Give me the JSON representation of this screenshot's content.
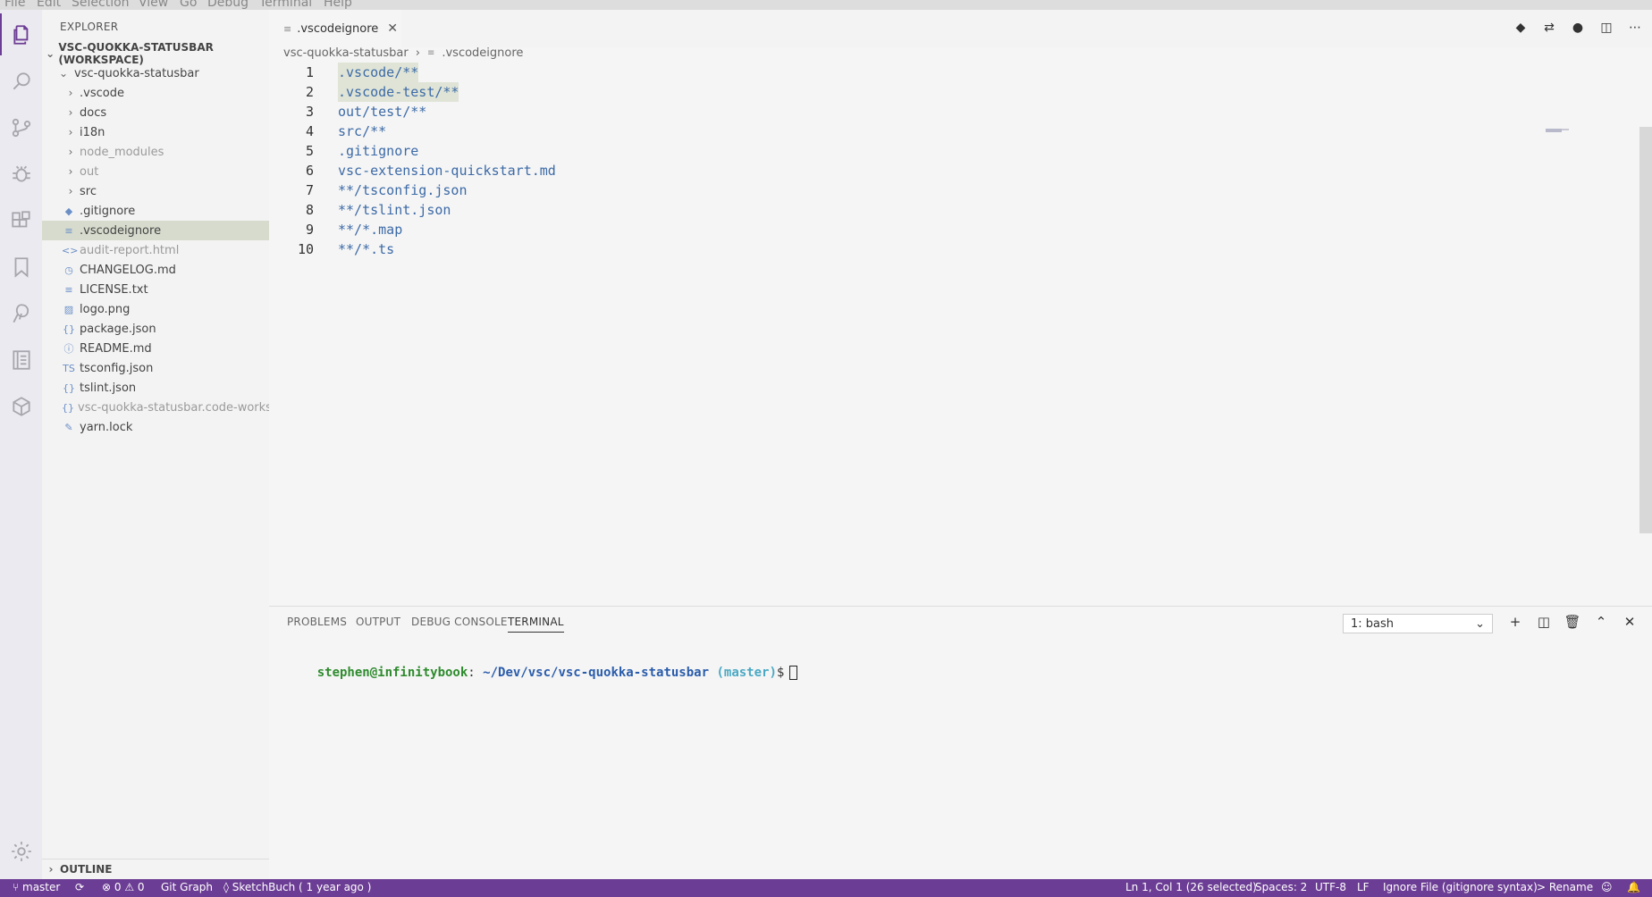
{
  "menu": [
    "File",
    "Edit",
    "Selection",
    "View",
    "Go",
    "Debug",
    "Terminal",
    "Help"
  ],
  "activity_bar": [
    "files-icon",
    "search-icon",
    "source-control-icon",
    "debug-icon",
    "extensions-icon",
    "bookmark-icon",
    "tree-icon",
    "notebook-icon",
    "package-icon"
  ],
  "sidebar": {
    "title": "EXPLORER",
    "workspace": "VSC-QUOKKA-STATUSBAR (WORKSPACE)",
    "root": "vsc-quokka-statusbar",
    "items": [
      {
        "label": ".vscode",
        "type": "folder"
      },
      {
        "label": "docs",
        "type": "folder"
      },
      {
        "label": "i18n",
        "type": "folder"
      },
      {
        "label": "node_modules",
        "type": "folder"
      },
      {
        "label": "out",
        "type": "folder"
      },
      {
        "label": "src",
        "type": "folder"
      },
      {
        "label": ".gitignore",
        "icon": "◆"
      },
      {
        "label": ".vscodeignore",
        "icon": "≡"
      },
      {
        "label": "audit-report.html",
        "icon": "<>"
      },
      {
        "label": "CHANGELOG.md",
        "icon": "◷"
      },
      {
        "label": "LICENSE.txt",
        "icon": "≡"
      },
      {
        "label": "logo.png",
        "icon": "▨"
      },
      {
        "label": "package.json",
        "icon": "{}"
      },
      {
        "label": "README.md",
        "icon": "ⓘ"
      },
      {
        "label": "tsconfig.json",
        "icon": "TS"
      },
      {
        "label": "tslint.json",
        "icon": "{}"
      },
      {
        "label": "vsc-quokka-statusbar.code-works...",
        "icon": "{}"
      },
      {
        "label": "yarn.lock",
        "icon": "✎"
      }
    ],
    "outline": "OUTLINE"
  },
  "editor": {
    "tab": ".vscodeignore",
    "breadcrumb": [
      "vsc-quokka-statusbar",
      ".vscodeignore"
    ],
    "lines": [
      ".vscode/**",
      ".vscode-test/**",
      "out/test/**",
      "src/**",
      ".gitignore",
      "vsc-extension-quickstart.md",
      "**/tsconfig.json",
      "**/tslint.json",
      "**/*.map",
      "**/*.ts"
    ],
    "line_numbers": [
      "1",
      "2",
      "3",
      "4",
      "5",
      "6",
      "7",
      "8",
      "9",
      "10"
    ]
  },
  "panel": {
    "tabs": [
      "PROBLEMS",
      "OUTPUT",
      "DEBUG CONSOLE",
      "TERMINAL"
    ],
    "terminal_select": "1: bash",
    "prompt_user": "stephen@infinitybook",
    "prompt_sep": ": ",
    "prompt_path": "~/Dev/vsc/vsc-quokka-statusbar",
    "prompt_branch": "(master)",
    "prompt_end": "$"
  },
  "status": {
    "branch": "master",
    "problems": "⊗ 0 ⚠ 0",
    "git_graph": "Git Graph",
    "sketch": "SketchBuch ( 1 year ago )",
    "cursor": "Ln 1, Col 1 (26 selected)",
    "spaces": "Spaces: 2",
    "encoding": "UTF-8",
    "eol": "LF",
    "language": "Ignore File (gitignore syntax)",
    "rename": "> Rename"
  },
  "colors": {
    "accent": "#6c3d94",
    "selected_row": "#d6dbcd",
    "code": "#3c6aa6"
  }
}
